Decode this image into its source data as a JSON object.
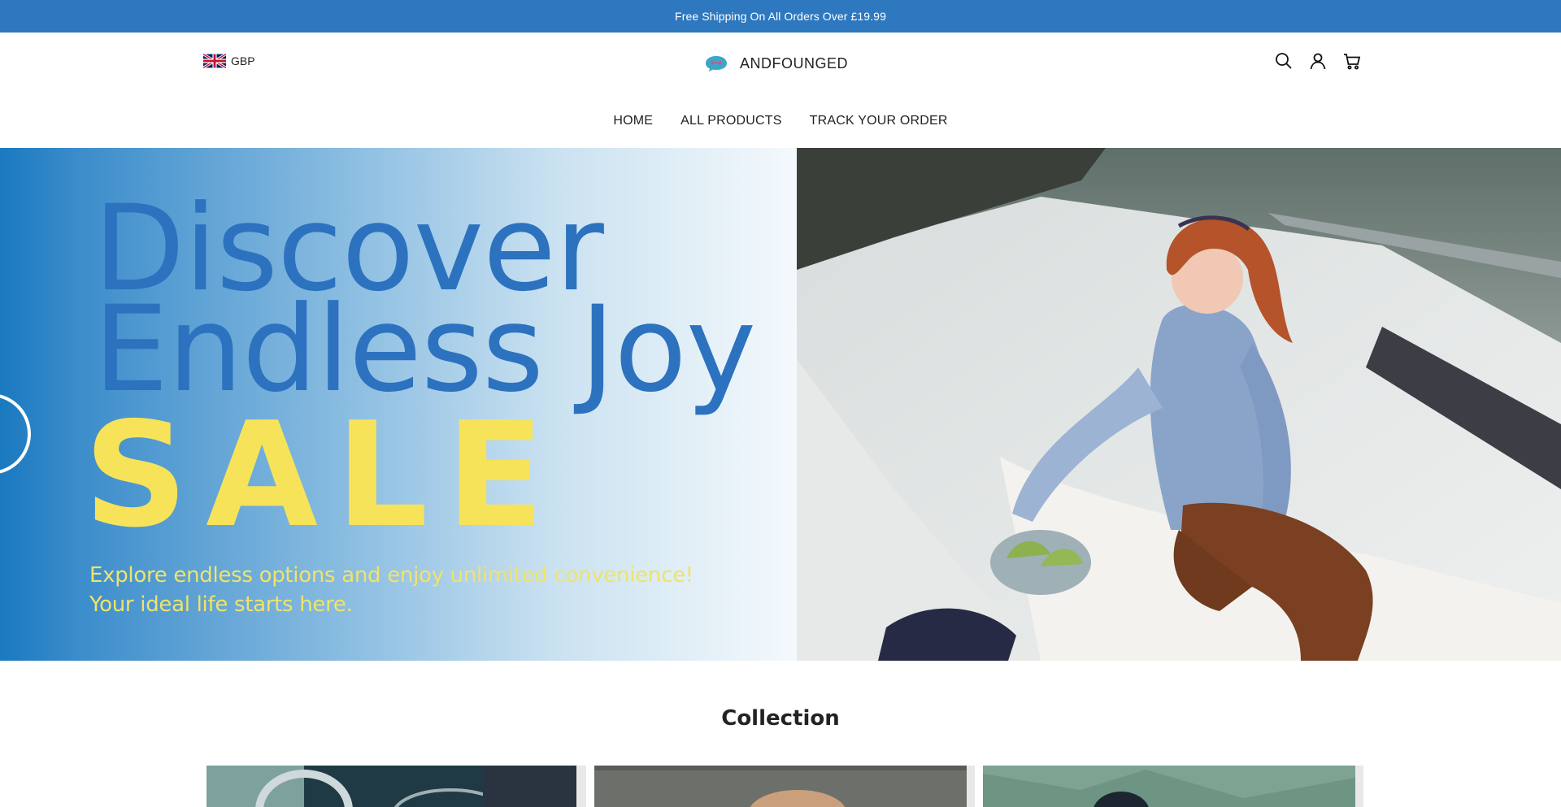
{
  "announcement": {
    "text": " Free Shipping On All Orders Over £19.99 "
  },
  "header": {
    "currency": {
      "code": "GBP",
      "flag_icon": "uk-flag-icon"
    },
    "logo": {
      "text": "ANDFOUNGED",
      "icon": "chat-bubble-logo-icon",
      "accent": "#3aa6c9"
    },
    "icons": [
      "search-icon",
      "account-icon",
      "cart-icon"
    ]
  },
  "nav": {
    "items": [
      {
        "label": "HOME"
      },
      {
        "label": "ALL PRODUCTS"
      },
      {
        "label": "TRACK YOUR ORDER"
      }
    ]
  },
  "hero": {
    "headline_line1": "Discover",
    "headline_line2": "Endless Joy",
    "sale": "SALE",
    "sub_line1": "Explore endless options and enjoy unlimited convenience!",
    "sub_line2": "Your ideal life starts here.",
    "colors": {
      "headline": "#2c72bf",
      "sale": "#f7e35a",
      "sub": "#efe36a",
      "gradient_start": "#1a79c0"
    }
  },
  "collection": {
    "title": "Collection",
    "tile_count": 3
  },
  "theme": {
    "accent": "#2e78bf"
  }
}
